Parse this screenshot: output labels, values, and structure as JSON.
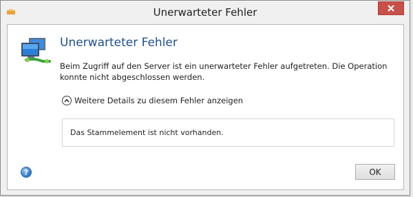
{
  "window": {
    "title": "Unerwarteter Fehler"
  },
  "dialog": {
    "heading": "Unerwarteter Fehler",
    "message": "Beim Zugriff auf den Server ist ein unerwarteter Fehler aufgetreten. Die Operation konnte nicht abgeschlossen werden.",
    "details_toggle_label": "Weitere Details zu diesem Fehler anzeigen",
    "details_text": "Das Stammelement ist nicht vorhanden.",
    "ok_label": "OK",
    "help_symbol": "?",
    "icons": {
      "main": "network-computers-icon",
      "toggle": "chevron-up-icon",
      "help": "help-icon",
      "close": "close-icon"
    }
  },
  "colors": {
    "heading": "#1d4f91",
    "close_button": "#c7504a"
  }
}
